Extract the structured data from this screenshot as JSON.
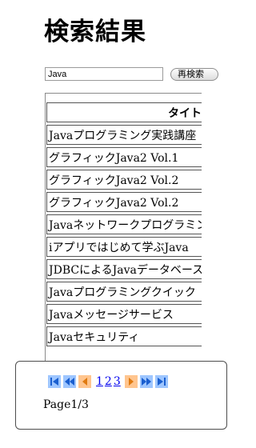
{
  "title": "検索結果",
  "search": {
    "value": "Java",
    "button_label": "再検索"
  },
  "table": {
    "header": "タイトル",
    "rows": [
      "Javaプログラミング実践講座",
      "グラフィックJava2 Vol.1",
      "グラフィックJava2 Vol.2",
      "グラフィックJava2 Vol.2",
      "Javaネットワークプログラミング",
      "iアプリではじめて学ぶJava",
      "JDBCによるJavaデータベース",
      "Javaプログラミングクイック",
      "Javaメッセージサービス",
      "Javaセキュリティ"
    ]
  },
  "pager": {
    "pages": [
      "1",
      "2",
      "3"
    ],
    "page_info": "Page1/3",
    "colors": {
      "nav_blue": "#9ec6ff",
      "nav_orange": "#ffc58e",
      "link": "#0000ee"
    }
  }
}
